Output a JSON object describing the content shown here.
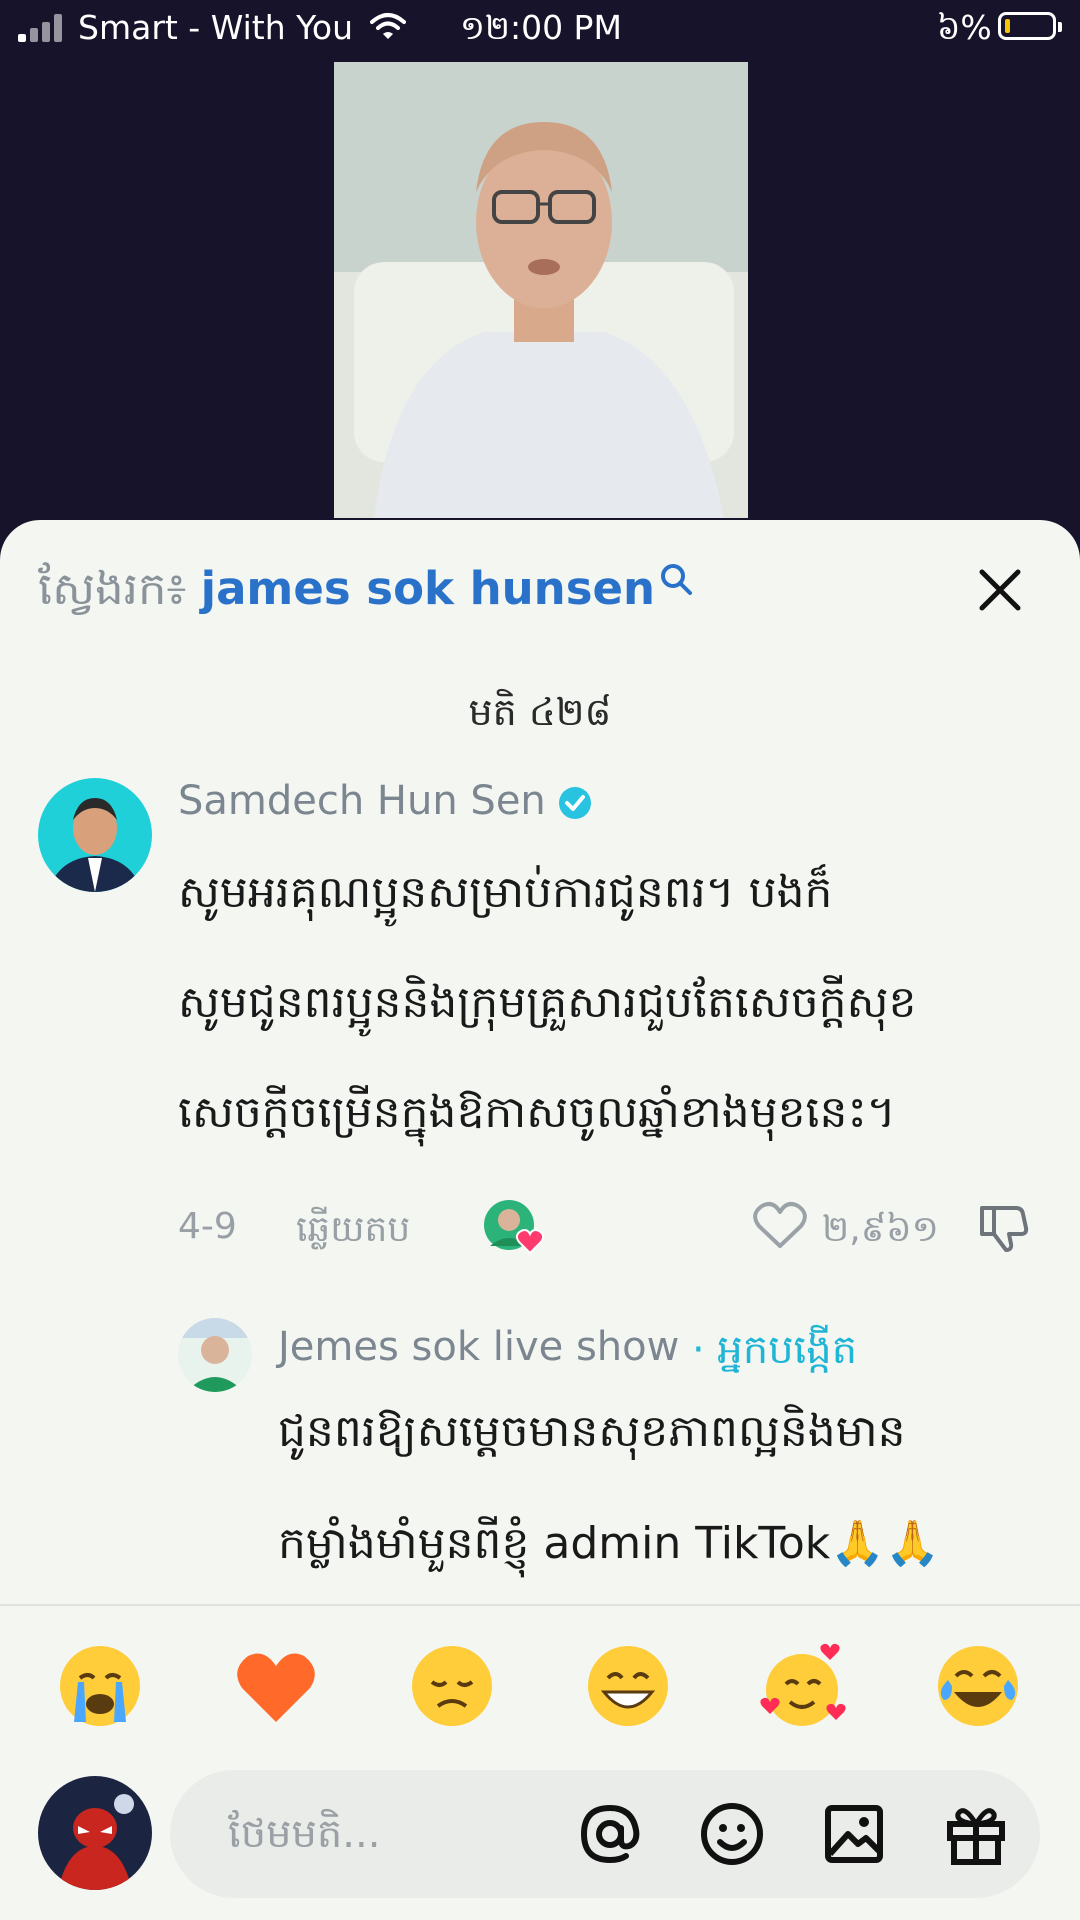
{
  "status_bar": {
    "carrier": "Smart - With You",
    "time": "១២:00 PM",
    "battery_pct": "៦%"
  },
  "search": {
    "label": "ស្វែងរក៖",
    "term": "james sok hunsen"
  },
  "comments_count": "មតិ ៤២៨",
  "comment": {
    "author": "Samdech Hun Sen",
    "lines": [
      "សូមអរគុណប្អូនសម្រាប់ការជូនពរ។ បងក៏",
      "សូមជូនពរប្អូននិងក្រុមគ្រួសារជួបតែសេចក្តីសុខ",
      "សេចក្តីចម្រើនក្នុងឱកាសចូលឆ្នាំខាងមុខនេះ។"
    ],
    "date": "4-9",
    "reply_label": "ឆ្លើយតប",
    "likes": "២,៩៦១"
  },
  "reply": {
    "author": "Jemes sok live show",
    "badge": " · អ្នកបង្កើត",
    "lines": [
      "ជូនពរឱ្យសម្តេចមានសុខភាពល្អនិងមាន",
      "កម្លាំងមាំមួនពីខ្ញុំ admin TikTok🙏🙏"
    ]
  },
  "quick_emojis": [
    "crying-face",
    "orange-heart",
    "disappointed-face",
    "grinning-face",
    "smiling-face-with-hearts",
    "tears-of-joy"
  ],
  "composer": {
    "placeholder": "ថែមមតិ..."
  },
  "colors": {
    "search_term": "#2a72c9",
    "verified": "#27c3e0",
    "liked_heart": "#ff3b6e",
    "background_top": "#17132a",
    "sheet": "#f4f6f2"
  }
}
